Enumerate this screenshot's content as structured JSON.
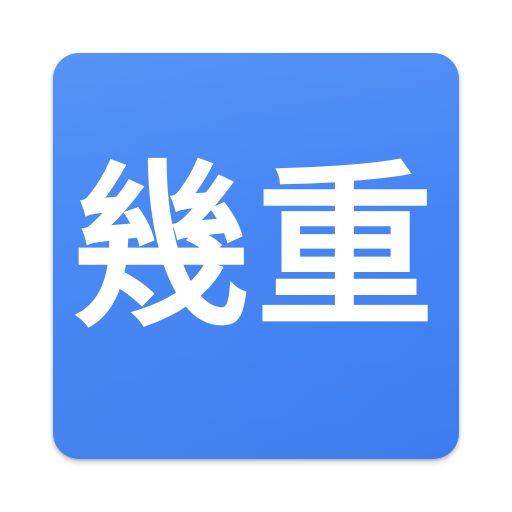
{
  "icon": {
    "label": "幾重",
    "background_color": "#4686f5",
    "text_color": "#ffffff"
  }
}
